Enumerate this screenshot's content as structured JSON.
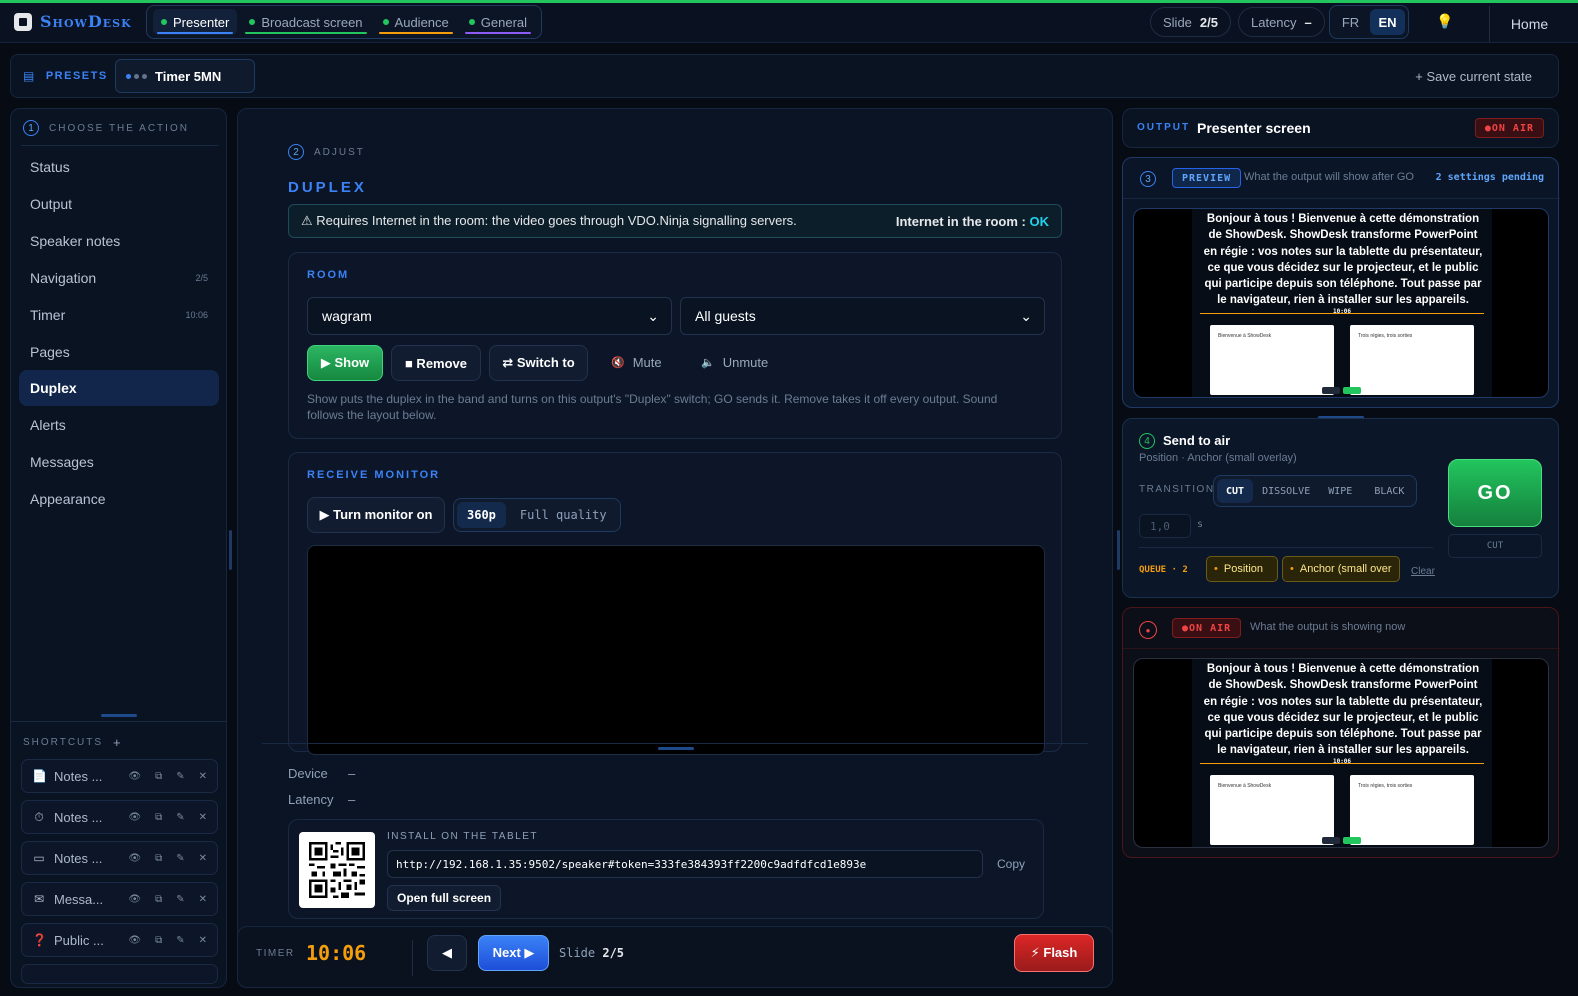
{
  "app": {
    "name": "ShowDesk"
  },
  "header": {
    "tabs": [
      {
        "label": "Presenter",
        "dot": "#22c55e",
        "underline": "#3b82f6"
      },
      {
        "label": "Broadcast screen",
        "dot": "#22c55e",
        "underline": "#22c55e"
      },
      {
        "label": "Audience",
        "dot": "#22c55e",
        "underline": "#f59e0b"
      },
      {
        "label": "General",
        "dot": "#22c55e",
        "underline": "#8b5cf6"
      }
    ],
    "slide_label": "Slide",
    "slide_value": "2/5",
    "latency_label": "Latency",
    "latency_value": "–",
    "lang_fr": "FR",
    "lang_en": "EN",
    "lang_active": "EN",
    "home": "Home"
  },
  "presets": {
    "label": "PRESETS",
    "chip": "Timer 5MN",
    "save": "+  Save current state"
  },
  "left": {
    "step": "1",
    "title": "CHOOSE THE ACTION",
    "nav": [
      {
        "label": "Status",
        "meta": ""
      },
      {
        "label": "Output",
        "meta": ""
      },
      {
        "label": "Speaker notes",
        "meta": ""
      },
      {
        "label": "Navigation",
        "meta": "2/5"
      },
      {
        "label": "Timer",
        "meta": "10:06"
      },
      {
        "label": "Pages",
        "meta": ""
      },
      {
        "label": "Duplex",
        "meta": ""
      },
      {
        "label": "Alerts",
        "meta": ""
      },
      {
        "label": "Messages",
        "meta": ""
      },
      {
        "label": "Appearance",
        "meta": ""
      }
    ],
    "active": "Duplex",
    "shortcuts_title": "SHORTCUTS",
    "shortcuts_add": "+",
    "shortcuts": [
      {
        "icon": "notes-icon",
        "glyph": "📄",
        "label": "Notes ..."
      },
      {
        "icon": "timer-icon",
        "glyph": "⏱",
        "label": "Notes ..."
      },
      {
        "icon": "screen-icon",
        "glyph": "▭",
        "label": "Notes ..."
      },
      {
        "icon": "mail-icon",
        "glyph": "✉",
        "label": "Messa..."
      },
      {
        "icon": "question-icon",
        "glyph": "❓",
        "label": "Public ..."
      }
    ]
  },
  "center": {
    "step": "2",
    "step_label": "ADJUST",
    "title": "DUPLEX",
    "requirement": "⚠ Requires Internet in the room: the video goes through VDO.Ninja signalling servers.",
    "internet_label": "Internet in the room : ",
    "internet_status": "OK",
    "room": {
      "title": "ROOM",
      "room_value": "wagram",
      "guests_value": "All guests",
      "show": "▶ Show",
      "remove": "■ Remove",
      "switch": "⇄ Switch to",
      "mute": "Mute",
      "unmute": "Unmute",
      "note": "Show puts the duplex in the band and turns on this output's \"Duplex\" switch; GO sends it. Remove takes it off every output. Sound follows the layout below."
    },
    "monitor": {
      "title": "RECEIVE MONITOR",
      "turn_on": "▶ Turn monitor on",
      "q1": "360p",
      "q2": "Full quality"
    },
    "device_label": "Device",
    "device_value": "–",
    "latency_label": "Latency",
    "latency_value": "–",
    "install": {
      "title": "INSTALL ON THE TABLET",
      "url": "http://192.168.1.35:9502/speaker#token=333fe384393ff2200c9adfdfcd1e893e",
      "copy": "Copy",
      "open": "Open full screen"
    }
  },
  "bottom": {
    "timer_label": "TIMER",
    "timer_value": "10:06",
    "prev": "◀",
    "next": "Next ▶",
    "slide_label": "Slide",
    "slide_value": "2/5",
    "flash": "⚡ Flash"
  },
  "output": {
    "label": "OUTPUT",
    "name": "Presenter screen",
    "on_air": "ON AIR",
    "preview": {
      "step": "3",
      "badge": "PREVIEW",
      "desc": "What the output will show after GO",
      "pending": "2 settings pending"
    },
    "slide_text": "Bonjour à tous ! Bienvenue à cette démonstration de ShowDesk. ShowDesk transforme PowerPoint en régie : vos notes sur la tablette du présentateur, ce que vous décidez sur le projecteur, et le public qui participe depuis son téléphone. Tout passe par le navigateur, rien à installer sur les appareils.",
    "slide_timer": "10:06",
    "thumb1_title": "Bienvenue à ShowDesk",
    "thumb2_title": "Trois régies, trois sorties",
    "send": {
      "step": "4",
      "title": "Send to air",
      "sub": "Position · Anchor (small overlay)",
      "transition_label": "TRANSITION",
      "transitions": [
        "CUT",
        "DISSOLVE",
        "WIPE",
        "BLACK"
      ],
      "active_transition": "CUT",
      "duration": "1,0",
      "unit": "s",
      "go": "GO",
      "go_sub": "CUT",
      "queue_label": "QUEUE · 2",
      "queue": [
        "Position",
        "Anchor (small over"
      ],
      "clear": "Clear"
    },
    "live": {
      "badge": "ON AIR",
      "desc": "What the output is showing now"
    }
  }
}
